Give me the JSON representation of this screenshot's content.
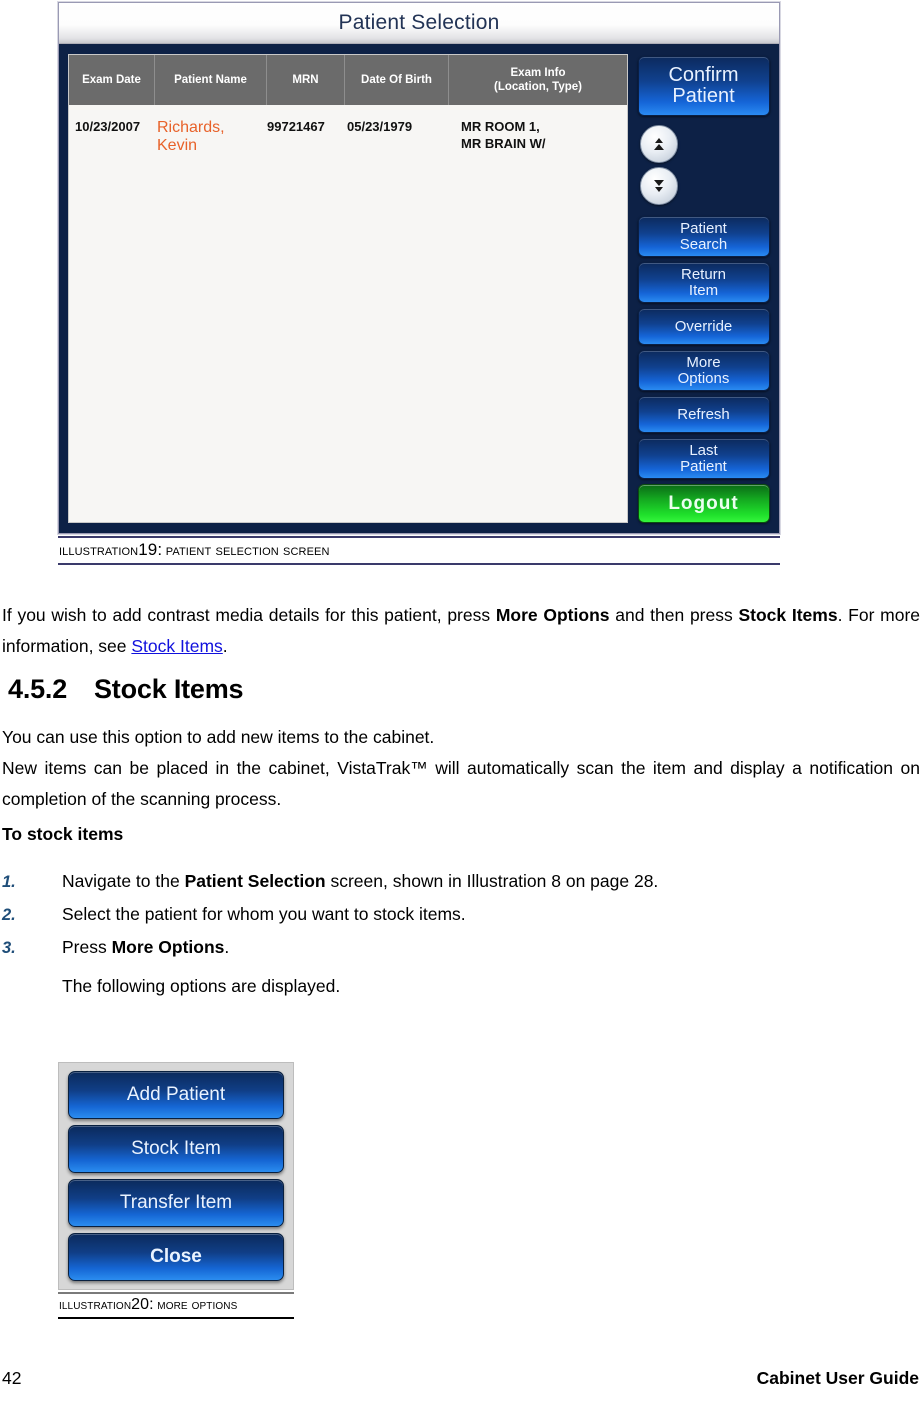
{
  "illustration19": {
    "screen": {
      "title": "Patient Selection",
      "table": {
        "headers": [
          "Exam Date",
          "Patient Name",
          "MRN",
          "Exam Info"
        ],
        "header_dob": "Date Of Birth",
        "header_exam_line1": "Exam Info",
        "header_exam_line2": "(Location, Type)",
        "rows": [
          {
            "exam_date": "10/23/2007",
            "patient_name": "Richards, Kevin",
            "mrn": "99721467",
            "dob": "05/23/1979",
            "exam_info_line1": "MR ROOM 1,",
            "exam_info_line2": "MR BRAIN W/"
          }
        ]
      },
      "buttons": {
        "confirm_patient_line1": "Confirm",
        "confirm_patient_line2": "Patient",
        "patient_search_line1": "Patient",
        "patient_search_line2": "Search",
        "return_item_line1": "Return",
        "return_item_line2": "Item",
        "override": "Override",
        "more_options_line1": "More",
        "more_options_line2": "Options",
        "refresh": "Refresh",
        "last_patient_line1": "Last",
        "last_patient_line2": "Patient",
        "logout": "Logout"
      },
      "scroll": {
        "up_label": "scroll up",
        "down_label": "scroll down"
      },
      "colors": {
        "panel_navy": "#0d2146",
        "button_blue": "#1565d8",
        "logout_green": "#1fe02b",
        "header_gray": "#6b6b6b",
        "patient_name_orange": "#e8622a"
      }
    },
    "caption": {
      "prefix": "Illustration",
      "number": "19",
      "separator": ":",
      "text": "Patient Selection screen"
    }
  },
  "intro_paragraph": {
    "part1": "If you wish to add contrast media details for this patient, press ",
    "bold1": "More Options",
    "part2": " and then press ",
    "bold2": "Stock Items",
    "part3": ". For more information, see ",
    "link": "Stock Items",
    "part4": "."
  },
  "section": {
    "number": "4.5.2",
    "title": "Stock Items"
  },
  "paragraphs": {
    "p1": "You can use this option to add new items to the cabinet.",
    "p2_part1": "New  items can be placed in the cabinet, VistaTrak™ will automatically scan the item and display a notification on completion of  the scanning process."
  },
  "procedure": {
    "heading": "To stock  items",
    "steps": [
      {
        "marker": "1.",
        "part1": "Navigate to the ",
        "bold": "Patient Selection",
        "part2": " screen, shown in Illustration 8 on page 28."
      },
      {
        "marker": "2.",
        "part1": "Select the patient for whom you want to stock items.",
        "bold": "",
        "part2": ""
      },
      {
        "marker": "3.",
        "part1": "Press ",
        "bold": "More Options",
        "part2": "."
      }
    ],
    "note": "The following options are  displayed."
  },
  "illustration20": {
    "buttons": [
      {
        "label": "Add Patient",
        "bold": false
      },
      {
        "label": "Stock Item",
        "bold": false
      },
      {
        "label": "Transfer Item",
        "bold": false
      },
      {
        "label": "Close",
        "bold": true
      }
    ],
    "caption": {
      "prefix": "Illustration",
      "number": "20",
      "separator": ":",
      "text": "More Options"
    }
  },
  "footer": {
    "page_number": "42",
    "guide_title": "Cabinet User Guide"
  }
}
